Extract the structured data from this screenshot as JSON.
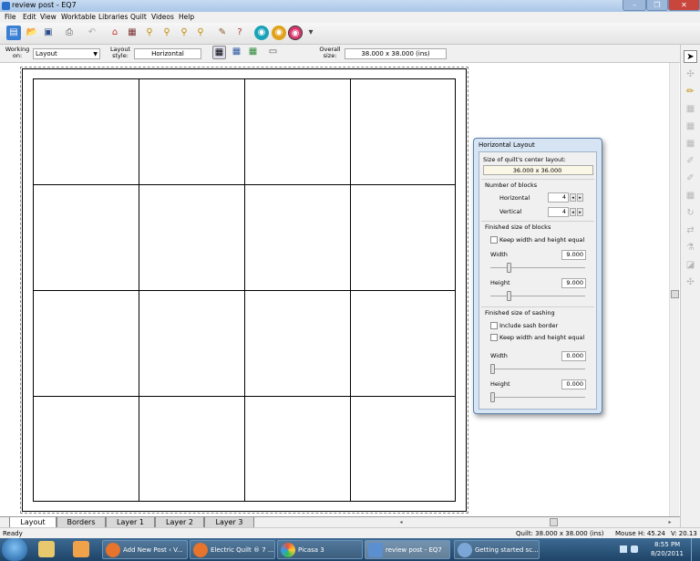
{
  "window": {
    "title": "review post - EQ7"
  },
  "menu": [
    "File",
    "Edit",
    "View",
    "Worktable",
    "Libraries",
    "Quilt",
    "Videos",
    "Help"
  ],
  "options_bar": {
    "working_on_label": "Working on:",
    "working_on_value": "Layout",
    "layout_style_label": "Layout style:",
    "layout_style_value": "Horizontal",
    "overall_size_label": "Overall size:",
    "overall_size_value": "38.000 x 38.000 (ins)"
  },
  "quilt": {
    "rows": 4,
    "columns": 4
  },
  "tabs": [
    {
      "label": "Layout",
      "active": true
    },
    {
      "label": "Borders",
      "active": false
    },
    {
      "label": "Layer 1",
      "active": false
    },
    {
      "label": "Layer 2",
      "active": false
    },
    {
      "label": "Layer 3",
      "active": false
    }
  ],
  "status": {
    "ready": "Ready",
    "quilt": "Quilt: 38.000 x 38.000 (ins)",
    "mouse": "Mouse",
    "h": "H: 45.24",
    "v": "V: 20.13"
  },
  "dialog": {
    "title": "Horizontal Layout",
    "size_label": "Size of quilt's center layout:",
    "size_value": "36.000 x 36.000",
    "number_of_blocks_label": "Number of blocks",
    "horizontal_label": "Horizontal",
    "horizontal_value": "4",
    "vertical_label": "Vertical",
    "vertical_value": "4",
    "finished_blocks_label": "Finished size of blocks",
    "keep_equal_label": "Keep width and height equal",
    "width_label": "Width",
    "width_value": "9.000",
    "height_label": "Height",
    "height_value": "9.000",
    "finished_sashing_label": "Finished size of sashing",
    "include_sash_border_label": "Include sash border",
    "keep_equal_sashing_label": "Keep width and height equal",
    "sash_width_label": "Width",
    "sash_width_value": "0.000",
    "sash_height_label": "Height",
    "sash_height_value": "0.000"
  },
  "taskbar": {
    "tasks": [
      "Add New Post ‹ V...",
      "Electric Quilt ® 7 ...",
      "Picasa 3",
      "review post - EQ7",
      "Getting started sc..."
    ],
    "clock_time": "8:55 PM",
    "clock_date": "8/20/2011"
  },
  "colors": {
    "accent": "#2a6fc9",
    "taskbar": "#1e4467",
    "dialog_frame": "#d6e4f3"
  }
}
